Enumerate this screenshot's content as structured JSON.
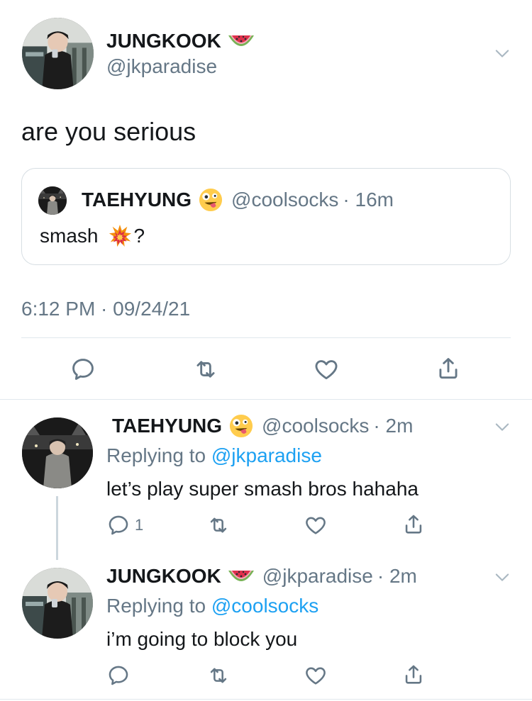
{
  "main_tweet": {
    "name": "JUNGKOOK",
    "name_emoji": "watermelon-emoji",
    "handle": "@jkparadise",
    "text": "are you serious",
    "timestamp": "6:12 PM · 09/24/21",
    "quoted": {
      "name": "TAEHYUNG",
      "name_emoji": "zany-face-emoji",
      "handle": "@coolsocks",
      "time": "· 16m",
      "text": "smash",
      "text_emoji": "collision-emoji",
      "text_suffix": "?"
    }
  },
  "replies": [
    {
      "name": "TAEHYUNG",
      "name_emoji": "zany-face-emoji",
      "handle": "@coolsocks",
      "time": "· 2m",
      "replying_prefix": "Replying to",
      "replying_to": "@jkparadise",
      "text": "let’s play super smash bros hahaha",
      "reply_count": "1"
    },
    {
      "name": "JUNGKOOK",
      "name_emoji": "watermelon-emoji",
      "handle": "@jkparadise",
      "time": "· 2m",
      "replying_prefix": "Replying to",
      "replying_to": "@coolsocks",
      "text": "i’m going to block you",
      "reply_count": ""
    }
  ],
  "colors": {
    "link": "#1da1f2",
    "secondary": "#657786",
    "divider": "#e1e8ed"
  }
}
